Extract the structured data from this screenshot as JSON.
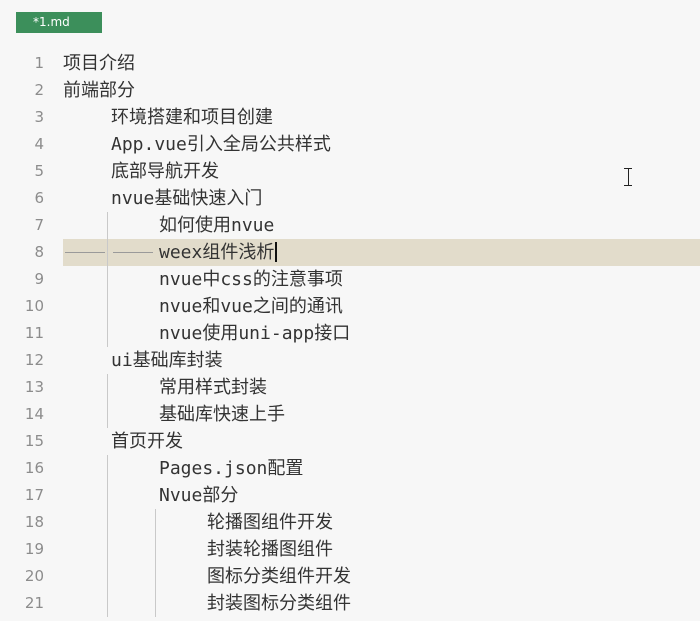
{
  "tab": {
    "title": "*1.md"
  },
  "editor": {
    "current_line": 8,
    "lines": [
      {
        "num": "1",
        "indent": 0,
        "text": "项目介绍"
      },
      {
        "num": "2",
        "indent": 0,
        "text": "前端部分"
      },
      {
        "num": "3",
        "indent": 1,
        "text": "环境搭建和项目创建"
      },
      {
        "num": "4",
        "indent": 1,
        "text": "App.vue引入全局公共样式"
      },
      {
        "num": "5",
        "indent": 1,
        "text": "底部导航开发"
      },
      {
        "num": "6",
        "indent": 1,
        "text": "nvue基础快速入门"
      },
      {
        "num": "7",
        "indent": 2,
        "text": "如何使用nvue"
      },
      {
        "num": "8",
        "indent": 2,
        "text": "weex组件浅析"
      },
      {
        "num": "9",
        "indent": 2,
        "text": "nvue中css的注意事项"
      },
      {
        "num": "10",
        "indent": 2,
        "text": "nvue和vue之间的通讯"
      },
      {
        "num": "11",
        "indent": 2,
        "text": "nvue使用uni-app接口"
      },
      {
        "num": "12",
        "indent": 1,
        "text": "ui基础库封装"
      },
      {
        "num": "13",
        "indent": 2,
        "text": "常用样式封装"
      },
      {
        "num": "14",
        "indent": 2,
        "text": "基础库快速上手"
      },
      {
        "num": "15",
        "indent": 1,
        "text": "首页开发"
      },
      {
        "num": "16",
        "indent": 2,
        "text": "Pages.json配置"
      },
      {
        "num": "17",
        "indent": 2,
        "text": "Nvue部分"
      },
      {
        "num": "18",
        "indent": 3,
        "text": "轮播图组件开发"
      },
      {
        "num": "19",
        "indent": 3,
        "text": "封装轮播图组件"
      },
      {
        "num": "20",
        "indent": 3,
        "text": "图标分类组件开发"
      },
      {
        "num": "21",
        "indent": 3,
        "text": "封装图标分类组件"
      }
    ]
  },
  "colors": {
    "tab_bg": "#3c8f5b",
    "current_line_bg": "#e2dccb",
    "editor_bg": "#f7f7f7"
  }
}
